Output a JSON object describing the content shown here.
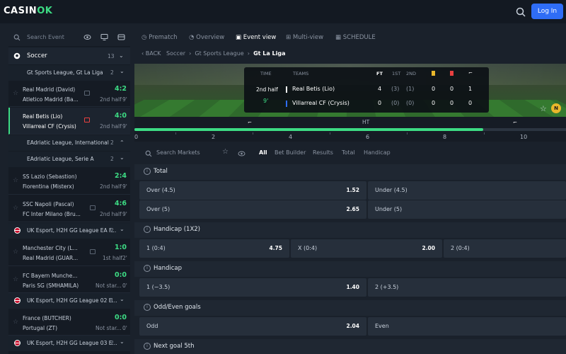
{
  "header": {
    "logo_main": "CASIN",
    "logo_accent": "OK",
    "login_label": "Log In"
  },
  "sidebar": {
    "search_placeholder": "Search Event",
    "sport": {
      "name": "Soccer",
      "count": "13"
    },
    "league1": {
      "name": "Gt Sports League, Gt La Liga",
      "count": "2"
    },
    "match1": {
      "home": "Real Madrid (David)",
      "away": "Atletico Madrid (Ba...",
      "score": "4:2",
      "status": "2nd half",
      "minute": "9'"
    },
    "match2": {
      "home": "Real Betis (Lio)",
      "away": "Villarreal CF (Crysis)",
      "score": "4:0",
      "status": "2nd half",
      "minute": "9'"
    },
    "league2": {
      "name": "EAdriatic League, International",
      "count": "2"
    },
    "league3": {
      "name": "EAdriatic League, Serie A",
      "count": "2"
    },
    "match3": {
      "home": "SS Lazio (Sebastion)",
      "away": "Fiorentina (Misterx)",
      "score": "2:4",
      "status": "2nd half",
      "minute": "9'"
    },
    "match4": {
      "home": "SSC Napoli (Pascal)",
      "away": "FC Inter Milano (Bru...",
      "score": "4:6",
      "status": "2nd half",
      "minute": "9'"
    },
    "league4": {
      "name": "UK Esport, H2H GG League EA F...",
      "count": "2"
    },
    "match5": {
      "home": "Manchester City (L...",
      "away": "Real Madrid (GUAR...",
      "score": "1:0",
      "status": "1st half",
      "minute": "2'"
    },
    "match6": {
      "home": "FC Bayern Munche...",
      "away": "Paris SG (SMHAMILA)",
      "score": "0:0",
      "status": "Not star...",
      "minute": "0'"
    },
    "league5": {
      "name": "UK Esport, H2H GG League 02 E...",
      "count": "1"
    },
    "match7": {
      "home": "France (BUTCHER)",
      "away": "Portugal (ZT)",
      "score": "0:0",
      "status": "Not star...",
      "minute": "0'"
    },
    "league6": {
      "name": "UK Esport, H2H GG League 03 E...",
      "count": "2"
    }
  },
  "tabs": {
    "prematch": "Prematch",
    "overview": "Overview",
    "event_view": "Event view",
    "multi_view": "Multi-view",
    "schedule": "SCHEDULE"
  },
  "breadcrumb": {
    "back": "BACK",
    "sport": "Soccer",
    "league": "Gt Sports League",
    "current": "Gt La Liga"
  },
  "scoreboard": {
    "h_time": "TIME",
    "h_teams": "TEAMS",
    "h_ft": "FT",
    "h_1st": "1ST",
    "h_2nd": "2ND",
    "period": "2nd half",
    "minute": "9'",
    "team1": "Real Betis (Lio)",
    "team2": "Villarreal CF (Crysis)",
    "t1_ft": "4",
    "t1_1st": "(3)",
    "t1_2nd": "(1)",
    "t1_y": "0",
    "t1_r": "0",
    "t1_c": "1",
    "t2_ft": "0",
    "t2_1st": "(0)",
    "t2_2nd": "(0)",
    "t2_y": "0",
    "t2_r": "0",
    "t2_c": "0",
    "badge": "N"
  },
  "timeline": {
    "ht_label": "HT",
    "ticks": [
      "0",
      "2",
      "4",
      "6",
      "8",
      "10"
    ],
    "progress": 0.808
  },
  "markets": {
    "search_placeholder": "Search Markets",
    "filters": {
      "all": "All",
      "bet_builder": "Bet Builder",
      "results": "Results",
      "total": "Total",
      "handicap": "Handicap"
    }
  },
  "sections": {
    "total": {
      "title": "Total",
      "o1_label": "Over (4.5)",
      "o1_value": "1.52",
      "o2_label": "Under (4.5)",
      "o3_label": "Over (5)",
      "o3_value": "2.65",
      "o4_label": "Under (5)"
    },
    "handicap12": {
      "title": "Handicap (1X2)",
      "o1_label": "1 (0:4)",
      "o1_value": "4.75",
      "o2_label": "X (0:4)",
      "o2_value": "2.00",
      "o3_label": "2 (0:4)"
    },
    "handicap": {
      "title": "Handicap",
      "o1_label": "1 (−3.5)",
      "o1_value": "1.40",
      "o2_label": "2 (+3.5)"
    },
    "oddeven": {
      "title": "Odd/Even goals",
      "o1_label": "Odd",
      "o1_value": "2.04",
      "o2_label": "Even"
    },
    "nextgoal": {
      "title": "Next goal 5th"
    }
  },
  "colors": {
    "accent": "#3ddc84",
    "login": "#2f6df6",
    "live": "#e84040"
  }
}
